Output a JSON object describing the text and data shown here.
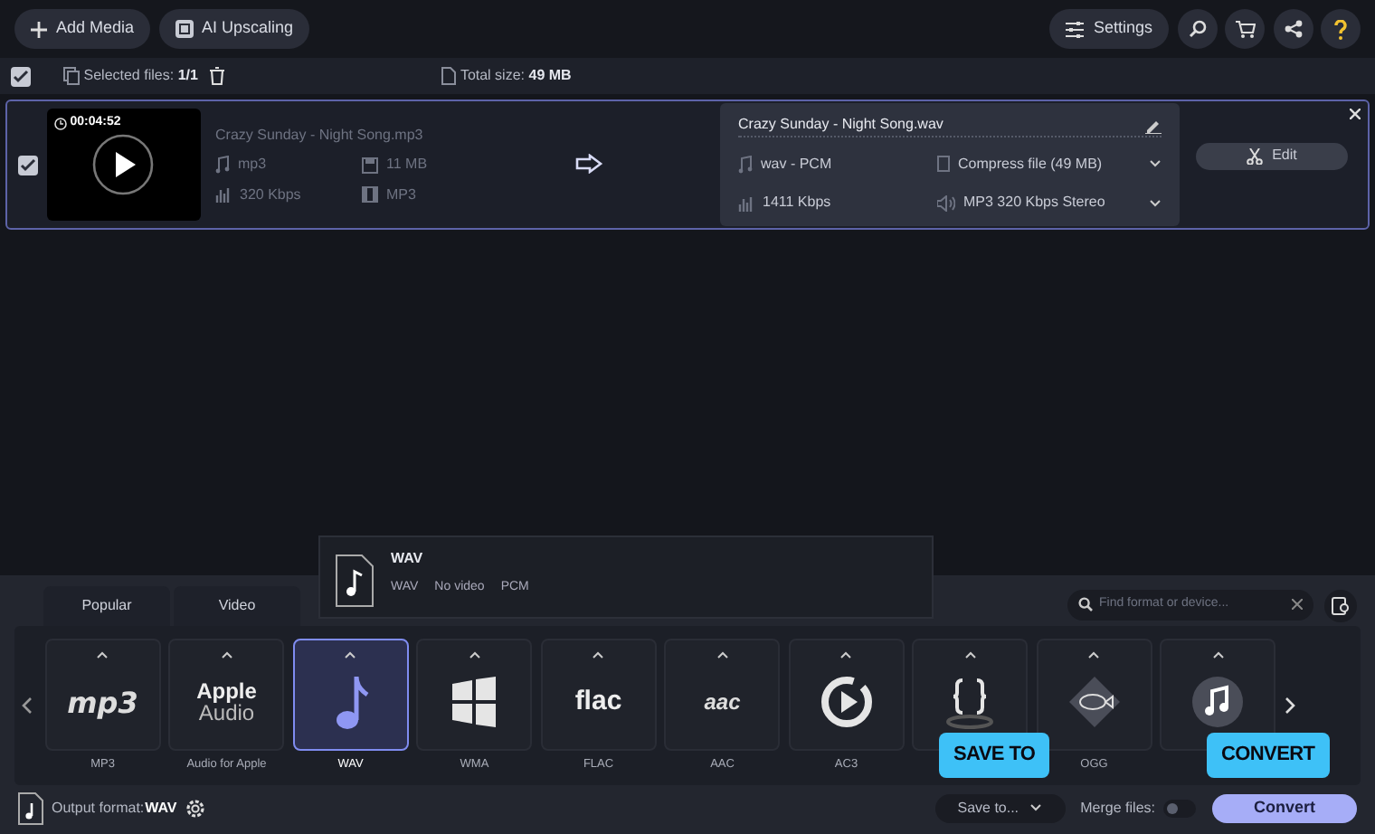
{
  "toolbar": {
    "left_buttons": [
      {
        "kind": "plus",
        "label": "Add Media"
      },
      {
        "kind": "ai",
        "label": "AI Upscaling"
      }
    ],
    "settings_label": "Settings",
    "icon_buttons": [
      {
        "kind": "search"
      },
      {
        "kind": "cart"
      },
      {
        "kind": "share"
      },
      {
        "kind": "help"
      }
    ]
  },
  "selection_bar": {
    "all_checked": true,
    "selected_label": "Selected files:",
    "selected_value": "1/1",
    "total_label": "Total size:",
    "total_value": "49 MB"
  },
  "file": {
    "checked": true,
    "duration": "00:04:52",
    "source": {
      "name": "Crazy Sunday - Night Song.mp3",
      "format": "mp3",
      "size": "11 MB",
      "bitrate": "320 Kbps",
      "codec": "MP3"
    },
    "output": {
      "name": "Crazy Sunday - Night Song.wav",
      "format": "wav - PCM",
      "bitrate": "1411 Kbps",
      "compress": "Compress file (49 MB)",
      "audio": "MP3 320 Kbps Stereo"
    },
    "edit_label": "Edit"
  },
  "format_popup": {
    "title": "WAV",
    "details": [
      "WAV",
      "No video",
      "PCM"
    ]
  },
  "tabs": [
    {
      "label": "Popular",
      "selected": false
    },
    {
      "label": "Video",
      "selected": false
    }
  ],
  "search": {
    "placeholder": "Find format or device..."
  },
  "formats": [
    {
      "kind": "mp3",
      "logo": "mp3",
      "label": "MP3",
      "selected": false
    },
    {
      "kind": "apple",
      "logo": "Apple",
      "logo_2": "Audio",
      "label": "Audio for Apple",
      "selected": false
    },
    {
      "kind": "note",
      "label": "WAV",
      "selected": true
    },
    {
      "kind": "windows",
      "label": "WMA",
      "selected": false
    },
    {
      "kind": "flac",
      "logo": "flac",
      "label": "FLAC",
      "selected": false
    },
    {
      "kind": "aac",
      "logo": "aac",
      "label": "AAC",
      "selected": false
    },
    {
      "kind": "play",
      "label": "AC3",
      "selected": false
    },
    {
      "kind": "braces",
      "selected": false
    },
    {
      "kind": "fish",
      "label": "OGG",
      "selected": false
    },
    {
      "kind": "music",
      "selected": false
    }
  ],
  "bottom_bar": {
    "output_label": "Output format:",
    "output_value": "WAV",
    "save_to": "Save to...",
    "merge_label": "Merge files:",
    "merge_on": false,
    "convert": "Convert"
  },
  "callouts": [
    {
      "kind": "save",
      "label": "SAVE TO"
    },
    {
      "kind": "convert",
      "label": "CONVERT"
    }
  ]
}
